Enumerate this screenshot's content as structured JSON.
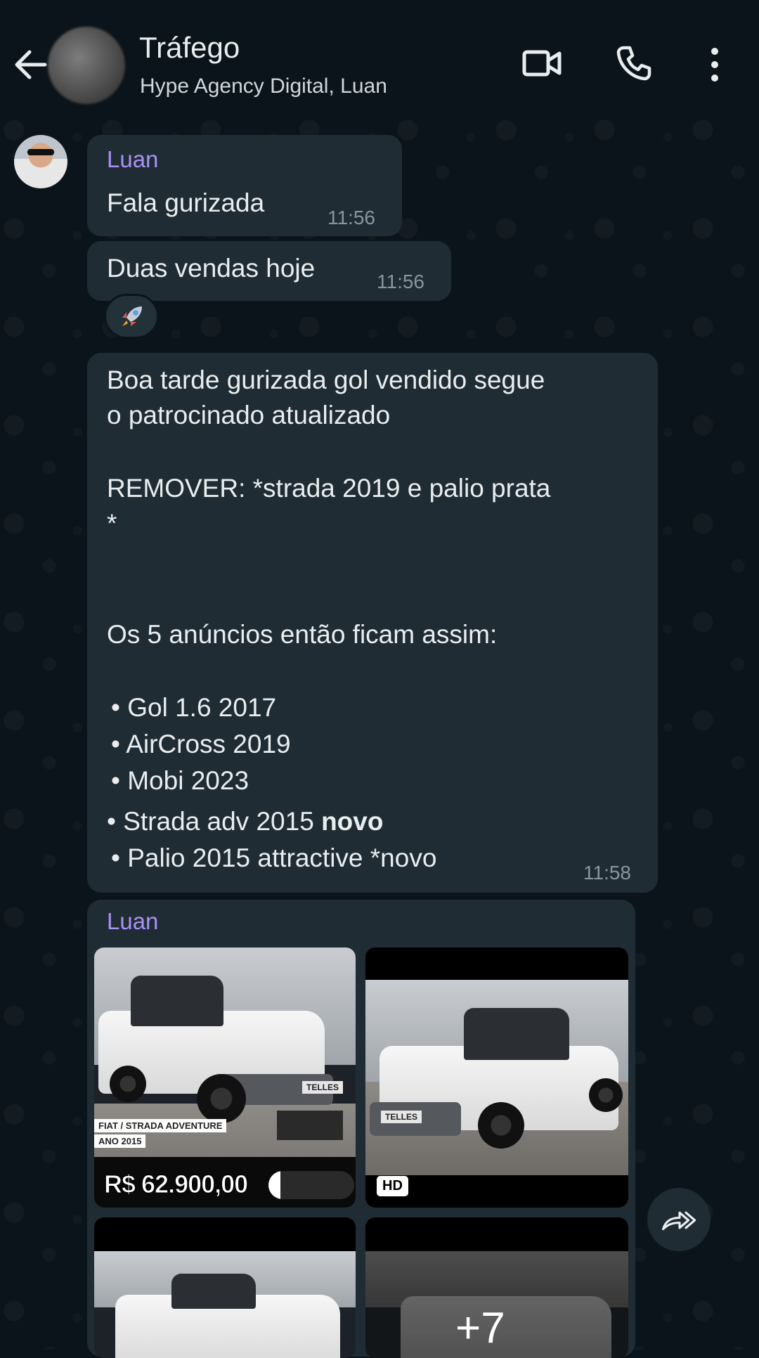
{
  "header": {
    "title": "Tráfego",
    "subtitle": "Hype Agency Digital, Luan"
  },
  "icons": {
    "back": "arrow-left-icon",
    "video": "video-call-icon",
    "phone": "phone-call-icon",
    "menu": "more-vert-icon",
    "reaction": "rocket-emoji",
    "forward": "forward-icon"
  },
  "messages": [
    {
      "sender": "Luan",
      "text": "Fala gurizada",
      "time": "11:56"
    },
    {
      "text": "Duas vendas hoje",
      "time": "11:56",
      "reaction": "🚀"
    },
    {
      "time": "11:58",
      "lines": {
        "l1": "Boa tarde gurizada gol vendido segue",
        "l2": "o patrocinado atualizado",
        "l3": "REMOVER: *strada 2019 e palio prata",
        "l4": "*",
        "l5": "Os 5 anúncios então ficam assim:",
        "b1": "•  Gol 1.6 2017",
        "b2": "•  AirCross 2019",
        "b3": "•  Mobi 2023",
        "b4_prefix": "• Strada adv 2015 ",
        "b4_bold": "novo",
        "b5": "•  Palio 2015 attractive *novo"
      }
    },
    {
      "sender": "Luan",
      "album": {
        "photo1_banner_line1": "FIAT / STRADA ADVENTURE",
        "photo1_banner_line2": "ANO 2015",
        "photo1_price": "R$ 62.900,00",
        "photo1_plate": "TELLES",
        "photo2_badge": "HD",
        "photo2_plate": "TELLES",
        "more_count": "+7"
      }
    }
  ]
}
